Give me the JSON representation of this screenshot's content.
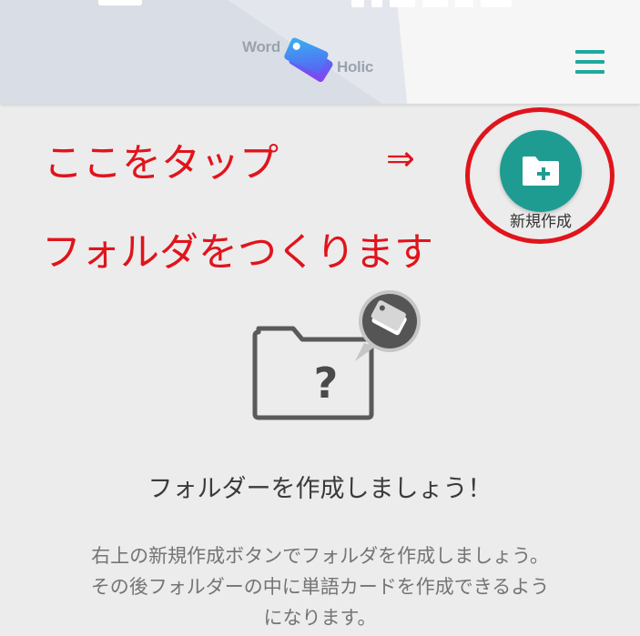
{
  "app": {
    "logo_word": "Word",
    "logo_holic": "Holic",
    "menu_icon": "hamburger-menu-icon"
  },
  "annotation": {
    "line1": "ここをタップ",
    "arrow": "⇒",
    "line2": "フォルダをつくります"
  },
  "new_folder": {
    "label": "新規作成",
    "icon": "folder-plus-icon"
  },
  "empty_state": {
    "icon": "folder-question-icon",
    "title": "フォルダーを作成しましょう！",
    "description_lines": [
      "右上の新規作成ボタンでフォルダを作成しましょう。",
      "その後フォルダーの中に単語カードを作成できるよう",
      "になります。"
    ]
  },
  "colors": {
    "accent": "#1f9c92",
    "menu_icon": "#20a99d",
    "annotation_red": "#e0141c",
    "background": "#ececec",
    "header_band": "#d9dee6"
  }
}
